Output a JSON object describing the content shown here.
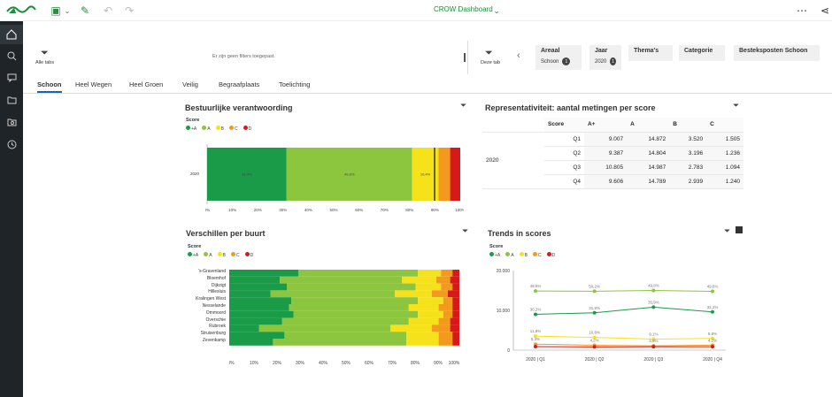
{
  "app": {
    "title": "CROW Dashboard"
  },
  "filters": {
    "left_label": "Alle tabs",
    "empty_text": "Er zijn geen filters toegepast.",
    "right_label": "Deze tab",
    "chips": [
      {
        "label": "Areaal",
        "value": "Schoon",
        "count": "1"
      },
      {
        "label": "Jaar",
        "value": "2020",
        "count": "1"
      },
      {
        "label": "Thema's"
      },
      {
        "label": "Categorie"
      },
      {
        "label": "Besteksposten Schoon"
      }
    ]
  },
  "tabs": [
    "Schoon",
    "Heel Wegen",
    "Heel Groen",
    "Veilig",
    "Begraafplaats",
    "Toelichting"
  ],
  "colors": {
    "aplus": "#1a9b48",
    "a": "#8cc63f",
    "b": "#f5e21a",
    "c": "#f39a1e",
    "d": "#d7191c"
  },
  "panels": {
    "p1": {
      "title": "Bestuurlijke verantwoording",
      "legend_title": "Score",
      "year": "2020",
      "legend": [
        "+A",
        "A",
        "B",
        "C",
        "D"
      ],
      "segments": [
        {
          "key": "aplus",
          "value": 31.4,
          "label": "31,4%"
        },
        {
          "key": "a",
          "value": 49.6,
          "label": "49,6%"
        },
        {
          "key": "b",
          "value": 10.4,
          "label": "10,4%"
        },
        {
          "key": "c",
          "value": 4.6,
          "label": "4,6%"
        },
        {
          "key": "d",
          "value": 4.0,
          "label": "4,0%"
        }
      ],
      "xticks": [
        "0%",
        "10%",
        "20%",
        "30%",
        "40%",
        "50%",
        "60%",
        "70%",
        "80%",
        "90%",
        "100%"
      ]
    },
    "p2": {
      "title": "Representativiteit: aantal metingen per score",
      "headers": [
        "Score",
        "A+",
        "A",
        "B",
        "C"
      ],
      "year": "2020",
      "rows": [
        {
          "q": "Q1",
          "v": [
            "9.007",
            "14.872",
            "3.520",
            "1.505"
          ]
        },
        {
          "q": "Q2",
          "v": [
            "9.387",
            "14.804",
            "3.196",
            "1.236"
          ]
        },
        {
          "q": "Q3",
          "v": [
            "10.805",
            "14.987",
            "2.783",
            "1.094"
          ]
        },
        {
          "q": "Q4",
          "v": [
            "9.606",
            "14.789",
            "2.939",
            "1.240"
          ]
        }
      ]
    },
    "p3": {
      "title": "Verschillen per buurt",
      "legend_title": "Score",
      "legend": [
        "+A",
        "A",
        "B",
        "C",
        "D"
      ],
      "buurten": [
        "'s-Gravenland",
        "Bloemhof",
        "Dijkzigt",
        "Hillesluis",
        "Kralingen West",
        "Nesselande",
        "Ommoord",
        "Overschie",
        "Rubroek",
        "Struisenburg",
        "Zevenkamp"
      ],
      "xticks": [
        "0%",
        "10%",
        "20%",
        "30%",
        "40%",
        "50%",
        "60%",
        "70%",
        "80%",
        "90%",
        "100%"
      ]
    },
    "p4": {
      "title": "Trends in scores",
      "legend_title": "Score",
      "legend": [
        "+A",
        "A",
        "B",
        "C",
        "D"
      ],
      "yticks": [
        "20.000",
        "10.000",
        "0"
      ],
      "xticks": [
        "2020 | Q1",
        "2020 | Q2",
        "2020 | Q3",
        "2020 | Q4"
      ]
    }
  },
  "chart_data": [
    {
      "type": "bar",
      "title": "Bestuurlijke verantwoording",
      "categories": [
        "2020"
      ],
      "series": [
        {
          "name": "+A",
          "values": [
            31.4
          ]
        },
        {
          "name": "A",
          "values": [
            49.6
          ]
        },
        {
          "name": "B",
          "values": [
            10.4
          ]
        },
        {
          "name": "C",
          "values": [
            4.6
          ]
        },
        {
          "name": "D",
          "values": [
            4.0
          ]
        }
      ]
    },
    {
      "type": "line",
      "title": "Trends in scores",
      "x": [
        "2020 | Q1",
        "2020 | Q2",
        "2020 | Q3",
        "2020 | Q4"
      ],
      "series": [
        {
          "name": "A",
          "values": [
            14872,
            14804,
            14987,
            14789
          ],
          "labels": [
            "49,6%",
            "50,2%",
            "49,8%",
            "49,6%"
          ]
        },
        {
          "name": "+A",
          "values": [
            9007,
            9387,
            10805,
            9606
          ],
          "labels": [
            "30,2%",
            "31,8%",
            "35,9%",
            "32,2%"
          ]
        },
        {
          "name": "B",
          "values": [
            3520,
            3196,
            2783,
            2939
          ],
          "labels": [
            "11,8%",
            "10,8%",
            "9,1%",
            "9,8%"
          ]
        },
        {
          "name": "C",
          "values": [
            1505,
            1236,
            1094,
            1240
          ],
          "labels": [
            "5,3%",
            "4,2%",
            "3,6%",
            "4,2%"
          ]
        },
        {
          "name": "D",
          "values": [
            900,
            800,
            850,
            870
          ]
        }
      ],
      "ylim": [
        0,
        20000
      ]
    }
  ]
}
